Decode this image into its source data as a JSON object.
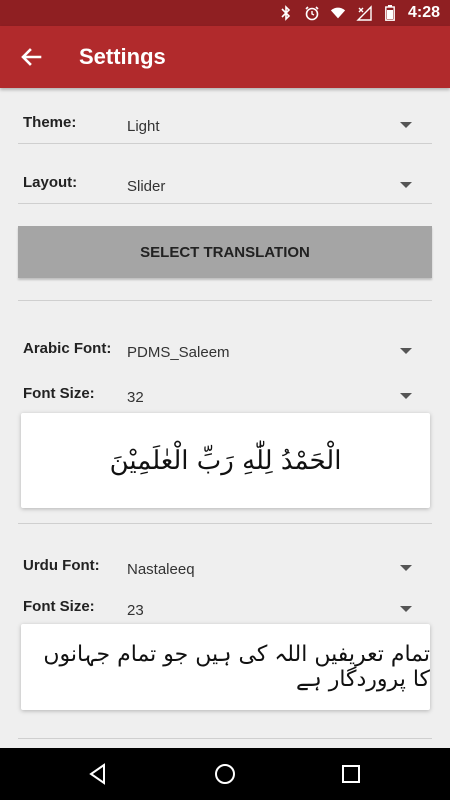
{
  "status": {
    "time": "4:28"
  },
  "appbar": {
    "title": "Settings"
  },
  "settings": {
    "theme": {
      "label": "Theme:",
      "value": "Light"
    },
    "layout": {
      "label": "Layout:",
      "value": "Slider"
    },
    "select_translation": "SELECT TRANSLATION",
    "arabic_font": {
      "label": "Arabic Font:",
      "value": "PDMS_Saleem"
    },
    "arabic_font_size": {
      "label": "Font Size:",
      "value": "32"
    },
    "arabic_preview": "الْحَمْدُ لِلّٰهِ رَبِّ الْعٰلَمِيْنَ",
    "urdu_font": {
      "label": "Urdu Font:",
      "value": "Nastaleeq"
    },
    "urdu_font_size": {
      "label": "Font Size:",
      "value": "23"
    },
    "urdu_preview": "تمام تعریفیں اللہ کی ہیں جو تمام جہانوں کا پروردگار ہے"
  },
  "icons": [
    "bluetooth-icon",
    "alarm-icon",
    "wifi-icon",
    "signal-icon",
    "battery-icon",
    "back-arrow-icon",
    "nav-back-icon",
    "nav-home-icon",
    "nav-recents-icon",
    "dropdown-arrow-icon"
  ]
}
